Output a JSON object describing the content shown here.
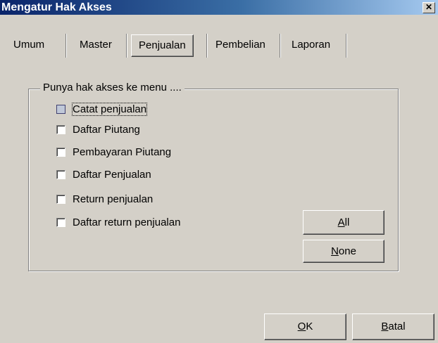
{
  "window": {
    "title": "Mengatur Hak Akses",
    "close_glyph": "✕"
  },
  "tabs": [
    {
      "label": "Umum",
      "active": false
    },
    {
      "label": "Master",
      "active": false
    },
    {
      "label": "Penjualan",
      "active": true
    },
    {
      "label": "Pembelian",
      "active": false
    },
    {
      "label": "Laporan",
      "active": false
    }
  ],
  "group": {
    "label": "Punya hak akses ke menu ....",
    "items": [
      {
        "label": "Catat penjualan",
        "checked": false,
        "focused": true
      },
      {
        "label": "Daftar Piutang",
        "checked": false
      },
      {
        "label": "Pembayaran Piutang",
        "checked": false
      },
      {
        "label": "Daftar Penjualan",
        "checked": false
      },
      {
        "label": "Return penjualan",
        "checked": false
      },
      {
        "label": "Daftar return penjualan",
        "checked": false
      }
    ]
  },
  "buttons": {
    "all": {
      "mnemonic": "A",
      "rest": "ll"
    },
    "none": {
      "mnemonic": "N",
      "rest": "one"
    },
    "ok": {
      "mnemonic": "O",
      "rest": "K"
    },
    "batal": {
      "mnemonic": "B",
      "rest": "atal"
    }
  }
}
